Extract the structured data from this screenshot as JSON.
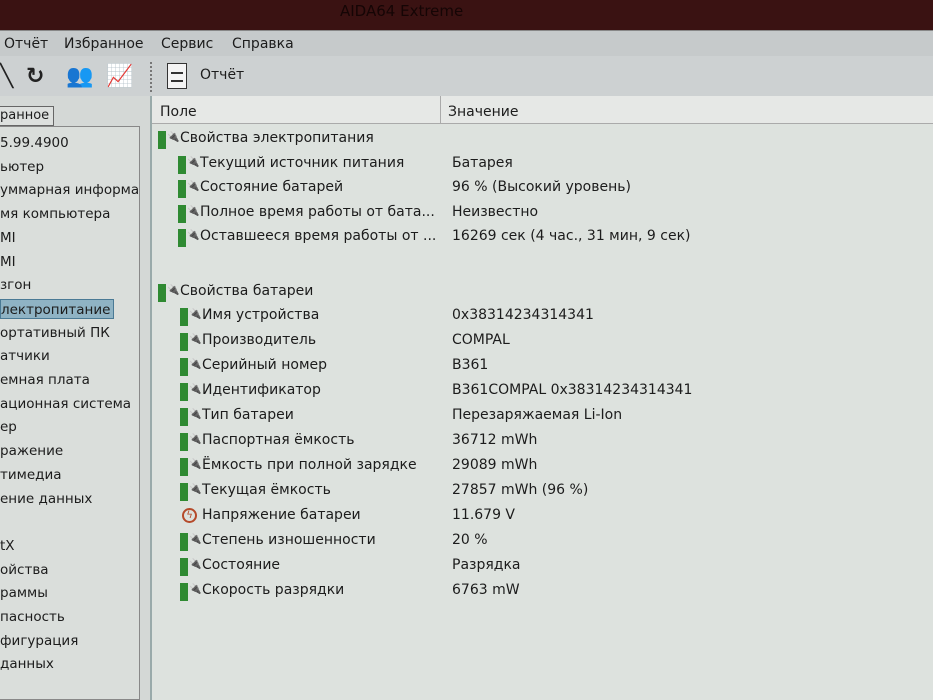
{
  "window": {
    "title": "AIDA64 Extreme"
  },
  "menu": [
    "Отчёт",
    "Избранное",
    "Сервис",
    "Справка"
  ],
  "toolbar": {
    "report_label": "Отчёт"
  },
  "sidebar": {
    "tab": "ранное",
    "items": [
      "5.99.4900",
      "ьютер",
      "уммарная информа",
      "мя компьютера",
      "MI",
      "MI",
      "згон",
      "лектропитание",
      "ортативный ПК",
      "атчики",
      "емная плата",
      "ационная система",
      "ер",
      "ражение",
      "тимедиа",
      "ение данных",
      "",
      "tX",
      "ойства",
      "раммы",
      "пасность",
      "фигурация",
      "данных"
    ],
    "selected_index": 7
  },
  "table": {
    "col_field": "Поле",
    "col_value": "Значение",
    "groups": [
      {
        "title": "Свойства электропитания",
        "rows": [
          {
            "field": "Текущий источник питания",
            "value": "Батарея",
            "icon": "battery-plug"
          },
          {
            "field": "Состояние батарей",
            "value": "96 % (Высокий уровень)",
            "icon": "battery-plug"
          },
          {
            "field": "Полное время работы от бата...",
            "value": "Неизвестно",
            "icon": "battery-plug"
          },
          {
            "field": "Оставшееся время работы от ...",
            "value": "16269 сек (4 час., 31 мин, 9 сек)",
            "icon": "battery-plug"
          }
        ]
      },
      {
        "title": "Свойства батареи",
        "rows": [
          {
            "field": "Имя устройства",
            "value": "0x38314234314341",
            "icon": "battery-plug"
          },
          {
            "field": "Производитель",
            "value": "COMPAL",
            "icon": "battery-plug"
          },
          {
            "field": "Серийный номер",
            "value": "B361",
            "icon": "battery-plug"
          },
          {
            "field": "Идентификатор",
            "value": "B361COMPAL 0x38314234314341",
            "icon": "battery-plug"
          },
          {
            "field": "Тип батареи",
            "value": "Перезаряжаемая Li-Ion",
            "icon": "battery-plug"
          },
          {
            "field": "Паспортная ёмкость",
            "value": "36712 mWh",
            "icon": "battery-plug"
          },
          {
            "field": "Ёмкость при полной зарядке",
            "value": "29089 mWh",
            "icon": "battery-plug"
          },
          {
            "field": "Текущая ёмкость",
            "value": "27857 mWh  (96 %)",
            "icon": "battery-plug"
          },
          {
            "field": "Напряжение батареи",
            "value": "11.679 V",
            "icon": "voltage"
          },
          {
            "field": "Степень изношенности",
            "value": "20 %",
            "icon": "battery-plug"
          },
          {
            "field": "Состояние",
            "value": "Разрядка",
            "icon": "battery-plug"
          },
          {
            "field": "Скорость разрядки",
            "value": "6763 mW",
            "icon": "battery-plug"
          }
        ]
      }
    ]
  }
}
